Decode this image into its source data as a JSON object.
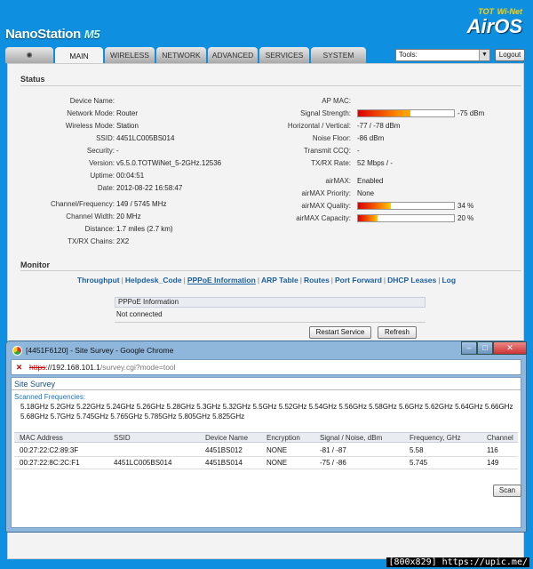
{
  "header": {
    "brand": "NanoStation",
    "brand_model": "M5",
    "logo_top": "TOT",
    "logo_top_sub": "Wi-Net",
    "logo_main": "AirOS"
  },
  "tabs": [
    {
      "label": "MAIN",
      "active": true
    },
    {
      "label": "WIRELESS"
    },
    {
      "label": "NETWORK"
    },
    {
      "label": "ADVANCED"
    },
    {
      "label": "SERVICES"
    },
    {
      "label": "SYSTEM"
    }
  ],
  "tools": {
    "value": "Tools:",
    "logout": "Logout"
  },
  "status": {
    "heading": "Status",
    "left": [
      {
        "label": "Device Name:",
        "value": ""
      },
      {
        "label": "Network Mode:",
        "value": "Router"
      },
      {
        "label": "Wireless Mode:",
        "value": "Station"
      },
      {
        "label": "SSID:",
        "value": "4451LC005BS014"
      },
      {
        "label": "Security:",
        "value": "-"
      },
      {
        "label": "Version:",
        "value": "v5.5.0.TOTWiNet_5-2GHz.12536"
      },
      {
        "label": "Uptime:",
        "value": "00:04:51"
      },
      {
        "label": "Date:",
        "value": "2012-08-22 16:58:47"
      },
      {
        "label": "Channel/Frequency:",
        "value": "149 / 5745 MHz"
      },
      {
        "label": "Channel Width:",
        "value": "20 MHz"
      },
      {
        "label": "Distance:",
        "value": "1.7 miles (2.7 km)"
      },
      {
        "label": "TX/RX Chains:",
        "value": "2X2"
      }
    ],
    "right": [
      {
        "label": "AP MAC:",
        "value": ""
      },
      {
        "label": "Signal Strength:",
        "value": "-75 dBm",
        "meter": 0.55
      },
      {
        "label": "Horizontal / Vertical:",
        "value": "-77 / -78 dBm"
      },
      {
        "label": "Noise Floor:",
        "value": "-86 dBm"
      },
      {
        "label": "Transmit CCQ:",
        "value": "-"
      },
      {
        "label": "TX/RX Rate:",
        "value": "52 Mbps / -"
      },
      {
        "label": "airMAX:",
        "value": "Enabled"
      },
      {
        "label": "airMAX Priority:",
        "value": "None"
      },
      {
        "label": "airMAX Quality:",
        "value": "34 %",
        "meter": 0.34
      },
      {
        "label": "airMAX Capacity:",
        "value": "20 %",
        "meter": 0.2
      }
    ]
  },
  "monitor": {
    "heading": "Monitor",
    "links": [
      "Throughput",
      "Helpdesk_Code",
      "PPPoE Information",
      "ARP Table",
      "Routes",
      "Port Forward",
      "DHCP Leases",
      "Log"
    ],
    "active_link": "PPPoE Information",
    "pppoe_header": "PPPoE Information",
    "pppoe_value": "Not connected",
    "restart_label": "Restart Service",
    "refresh_label": "Refresh"
  },
  "popup": {
    "title": "[4451F6120] - Site Survey - Google Chrome",
    "url_scheme": "https",
    "url_host": "://192.168.101.1",
    "url_path": "/survey.cgi?mode=tool",
    "heading": "Site Survey",
    "scanned_label": "Scanned Frequencies:",
    "frequencies": "5.18GHz 5.2GHz 5.22GHz 5.24GHz 5.26GHz 5.28GHz 5.3GHz 5.32GHz 5.5GHz 5.52GHz 5.54GHz 5.56GHz 5.58GHz 5.6GHz 5.62GHz 5.64GHz 5.66GHz 5.68GHz 5.7GHz 5.745GHz 5.765GHz 5.785GHz 5.805GHz 5.825GHz",
    "columns": [
      "MAC Address",
      "SSID",
      "Device Name",
      "Encryption",
      "Signal / Noise, dBm",
      "Frequency, GHz",
      "Channel"
    ],
    "rows": [
      [
        "00:27:22:C2:89:3F",
        "",
        "4451BS012",
        "NONE",
        "-81 / -87",
        "5.58",
        "116"
      ],
      [
        "00:27:22:8C:2C:F1",
        "4451LC005BS014",
        "4451BS014",
        "NONE",
        "-75 / -86",
        "5.745",
        "149"
      ]
    ],
    "scan_label": "Scan",
    "win_buttons": [
      "–",
      "□",
      "✕"
    ]
  },
  "credit": "[800x829] https://upic.me/",
  "colors": {
    "background": "#0f8fe0",
    "link": "#1a5f9e",
    "panel": "#f3f3f3"
  }
}
